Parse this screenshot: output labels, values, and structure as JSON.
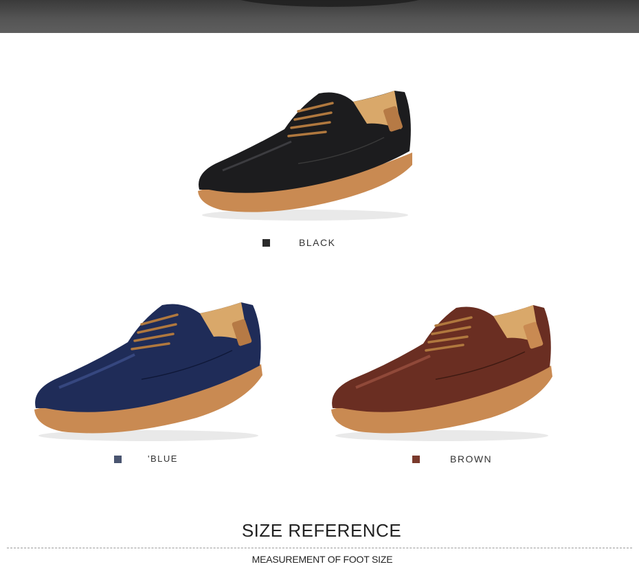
{
  "colors": {
    "black": {
      "label": "BLACK",
      "swatch": "#2a2a2a",
      "upper": "#1c1c1e",
      "upper_highlight": "#4a4a4e"
    },
    "blue": {
      "label": "BLUE",
      "label_prefix": "'",
      "swatch": "#4a5570",
      "upper": "#1f2c58",
      "upper_highlight": "#3c4f8a"
    },
    "brown": {
      "label": "BROWN",
      "swatch": "#7a3a2c",
      "upper": "#6a2e22",
      "upper_highlight": "#9a5040"
    }
  },
  "sole_color": "#c98a52",
  "lace_color": "#b0783e",
  "lining_color": "#d9a86a",
  "size_reference": {
    "title": "SIZE REFERENCE",
    "subtitle": "MEASUREMENT OF FOOT SIZE"
  }
}
